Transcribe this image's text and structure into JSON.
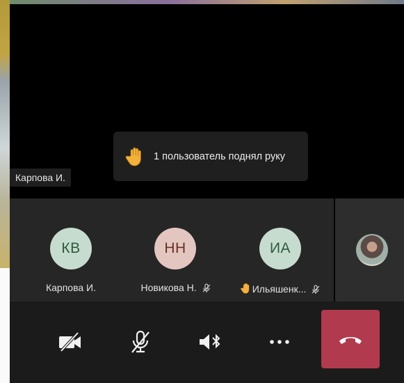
{
  "stage": {
    "speaker_name": "Карпова И.",
    "notification": "1 пользователь поднял руку"
  },
  "participants": [
    {
      "initials": "КВ",
      "name": "Карпова И.",
      "avatar_color": "#c6dccf",
      "text_color": "#2d5b3e",
      "muted": false,
      "hand_raised": false
    },
    {
      "initials": "НН",
      "name": "Новикова Н.",
      "avatar_color": "#e3c6c0",
      "text_color": "#6b2f2a",
      "muted": true,
      "hand_raised": false
    },
    {
      "initials": "ИА",
      "name": "Ильяшенк...",
      "avatar_color": "#c6dccf",
      "text_color": "#2d5b3e",
      "muted": true,
      "hand_raised": true
    }
  ],
  "controls": {
    "camera": "camera-off-icon",
    "mic": "mic-off-icon",
    "speaker": "speaker-bluetooth-icon",
    "more": "more-icon",
    "hangup": "hang-up-icon",
    "hangup_color": "#b23a4e"
  }
}
